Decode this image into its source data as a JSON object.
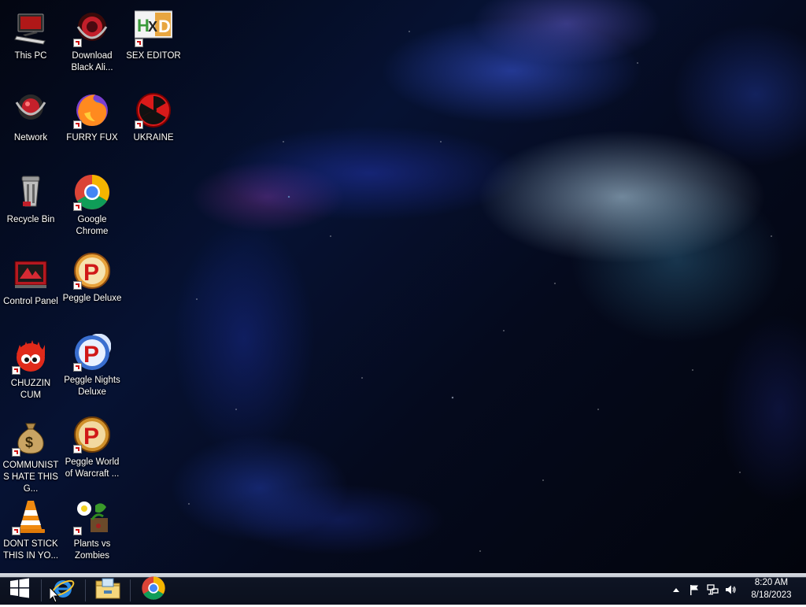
{
  "desktop": {
    "icons": [
      {
        "label": "This PC",
        "icon": "this-pc-icon"
      },
      {
        "label": "Download Black Ali...",
        "icon": "black-alien-icon"
      },
      {
        "label": "SEX EDITOR",
        "icon": "hxd-editor-icon"
      },
      {
        "label": "Network",
        "icon": "network-icon"
      },
      {
        "label": "FURRY FUX",
        "icon": "firefox-icon"
      },
      {
        "label": "UKRAINE",
        "icon": "radiation-icon"
      },
      {
        "label": "Recycle Bin",
        "icon": "recycle-bin-icon"
      },
      {
        "label": "Google Chrome",
        "icon": "chrome-icon"
      },
      {
        "label": "Control Panel",
        "icon": "control-panel-icon"
      },
      {
        "label": "Peggle Deluxe",
        "icon": "peggle-icon"
      },
      {
        "label": "CHUZZIN CUM",
        "icon": "chuzzle-icon"
      },
      {
        "label": "Peggle Nights Deluxe",
        "icon": "peggle-nights-icon"
      },
      {
        "label": "COMMUNISTS HATE THIS G...",
        "icon": "money-bag-icon"
      },
      {
        "label": "Peggle World of Warcraft ...",
        "icon": "peggle-wow-icon"
      },
      {
        "label": "DONT STICK THIS IN YO...",
        "icon": "vlc-cone-icon"
      },
      {
        "label": "Plants vs Zombies",
        "icon": "plants-vs-zombies-icon"
      }
    ]
  },
  "taskbar": {
    "start": {
      "icon": "windows-logo-icon"
    },
    "pinned": [
      {
        "name": "Internet Explorer",
        "icon": "internet-explorer-icon"
      },
      {
        "name": "File Explorer",
        "icon": "file-explorer-icon"
      },
      {
        "name": "Google Chrome",
        "icon": "chrome-icon"
      }
    ],
    "tray": {
      "icons": [
        "show-hidden-icons-chevron",
        "action-center-flag-icon",
        "network-icon",
        "volume-icon"
      ],
      "time": "8:20 AM",
      "date": "8/18/2023"
    }
  },
  "colors": {
    "taskbar_bg": "#0b101d",
    "label_text": "#ffffff",
    "accent_blue": "#1e90ff"
  }
}
